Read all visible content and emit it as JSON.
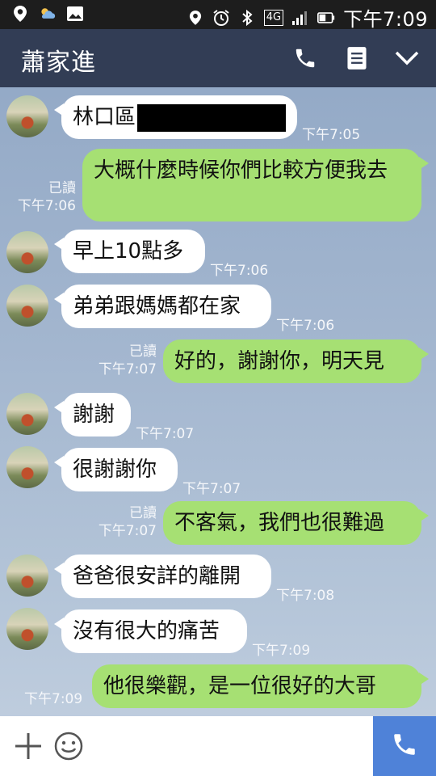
{
  "status_bar": {
    "time": "下午7:09",
    "network": "4G",
    "icons": [
      "location-icon",
      "weather-icon",
      "image-icon",
      "location-icon",
      "alarm-icon",
      "bluetooth-icon",
      "signal-icon",
      "battery-icon"
    ]
  },
  "header": {
    "title": "蕭家進",
    "icons": [
      "phone-icon",
      "menu-icon",
      "chevron-down-icon"
    ]
  },
  "messages": [
    {
      "dir": "in",
      "text": "林口區",
      "redacted": true,
      "time": "下午7:05"
    },
    {
      "dir": "out",
      "text": "大概什麼時候你們比較方便我去",
      "read": "已讀",
      "time": "下午7:06"
    },
    {
      "dir": "in",
      "text": "早上10點多",
      "time": "下午7:06"
    },
    {
      "dir": "in",
      "text": "弟弟跟媽媽都在家",
      "time": "下午7:06"
    },
    {
      "dir": "out",
      "text": "好的，謝謝你，明天見",
      "read": "已讀",
      "time": "下午7:07"
    },
    {
      "dir": "in",
      "text": "謝謝",
      "time": "下午7:07"
    },
    {
      "dir": "in",
      "text": "很謝謝你",
      "time": "下午7:07"
    },
    {
      "dir": "out",
      "text": "不客氣，我們也很難過",
      "read": "已讀",
      "time": "下午7:07"
    },
    {
      "dir": "in",
      "text": "爸爸很安詳的離開",
      "time": "下午7:08"
    },
    {
      "dir": "in",
      "text": "沒有很大的痛苦",
      "time": "下午7:09"
    },
    {
      "dir": "out",
      "text": "他很樂觀，是一位很好的大哥",
      "time": "下午7:09"
    }
  ],
  "input_bar": {
    "icons": [
      "plus-icon",
      "emoji-icon",
      "call-icon"
    ]
  },
  "colors": {
    "header_bg": "#323d55",
    "outgoing_bubble": "#a6e073",
    "incoming_bubble": "#ffffff",
    "call_button": "#4f82d8"
  }
}
